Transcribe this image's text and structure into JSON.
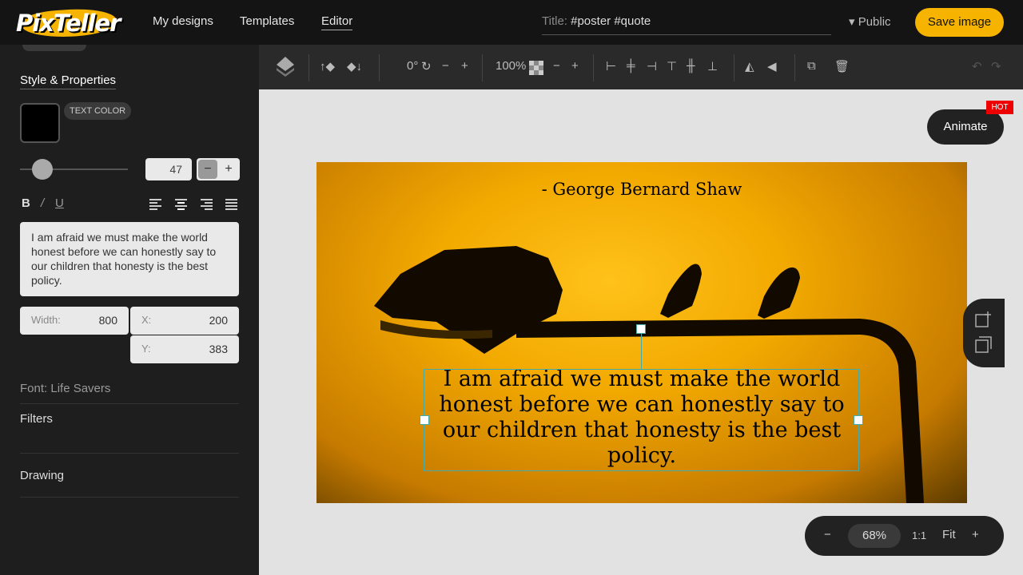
{
  "nav": {
    "logo": "PixTeller",
    "links": [
      "My designs",
      "Templates",
      "Editor"
    ],
    "title_label": "Title:",
    "title_value": "#poster #quote",
    "visibility": "▾ Public",
    "save_label": "Save image"
  },
  "sidebar": {
    "section_title": "Style & Properties",
    "text_color_label": "TEXT COLOR",
    "text_color": "#000000",
    "font_size": "47",
    "bold": "B",
    "italic": "/",
    "underline": "U",
    "text_content": "I am afraid we must make the world honest before we can honestly say to our children that honesty is the best policy.",
    "width_label": "Width:",
    "width_value": "800",
    "x_label": "X:",
    "x_value": "200",
    "y_label": "Y:",
    "y_value": "383",
    "font_label": "Font:",
    "font_value": "Life Savers",
    "filters_label": "Filters",
    "drawing_label": "Drawing"
  },
  "toolbar": {
    "rotation": "0°",
    "opacity": "100%"
  },
  "canvas": {
    "author": "- George Bernard Shaw",
    "quote": "I am afraid we must make the world honest before we can honestly say to our children that honesty is the best policy."
  },
  "floating": {
    "animate_label": "Animate",
    "hot_label": "HOT",
    "zoom_value": "68%",
    "zoom_1to1": "1:1",
    "zoom_fit": "Fit"
  },
  "colors": {
    "accent": "#f6b400",
    "selection": "#44aaaa"
  }
}
